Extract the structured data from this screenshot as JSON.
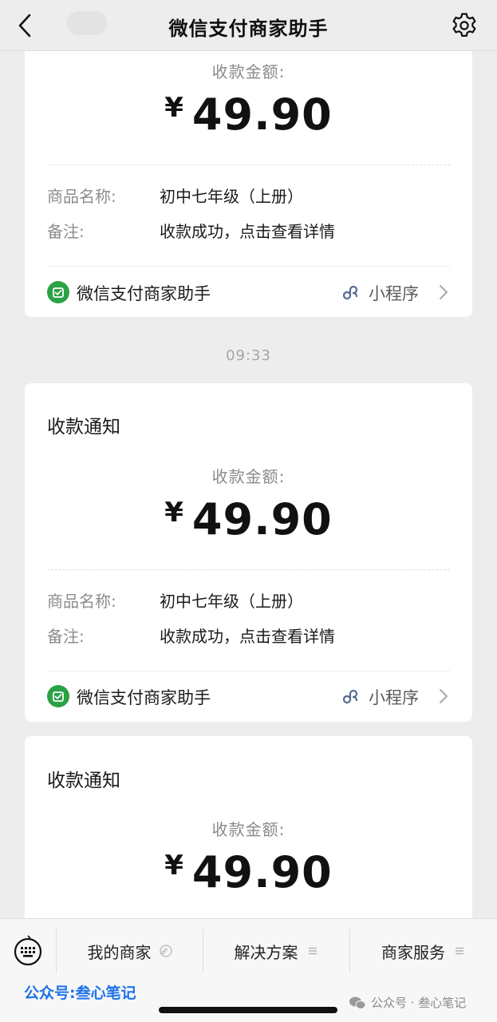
{
  "nav": {
    "title": "微信支付商家助手",
    "back_icon": "chevron-left-icon",
    "settings_icon": "gear-icon"
  },
  "cards": [
    {
      "title": "",
      "amount_label": "收款金额:",
      "currency": "¥",
      "amount": "49.90",
      "product_label": "商品名称:",
      "product_value": "初中七年级（上册）",
      "note_label": "备注:",
      "note_value": "收款成功，点击查看详情",
      "footer_name": "微信支付商家助手",
      "footer_link": "小程序"
    },
    {
      "title": "收款通知",
      "amount_label": "收款金额:",
      "currency": "¥",
      "amount": "49.90",
      "product_label": "商品名称:",
      "product_value": "初中七年级（上册）",
      "note_label": "备注:",
      "note_value": "收款成功，点击查看详情",
      "footer_name": "微信支付商家助手",
      "footer_link": "小程序"
    },
    {
      "title": "收款通知",
      "amount_label": "收款金额:",
      "currency": "¥",
      "amount": "49.90"
    }
  ],
  "timestamp": "09:33",
  "bottom_menu": {
    "items": [
      {
        "label": "我的商家",
        "icon": "mini-program-icon"
      },
      {
        "label": "解决方案",
        "icon": "menu-lines-icon"
      },
      {
        "label": "商家服务",
        "icon": "menu-lines-icon"
      }
    ],
    "keyboard_icon": "keyboard-icon"
  },
  "watermark": {
    "left_text": "公众号:叁心笔记",
    "right_text": "公众号 · 叁心笔记"
  },
  "colors": {
    "background": "#ededed",
    "card": "#ffffff",
    "wechat_green": "#2ba245",
    "link_blue": "#576b95",
    "watermark_blue": "#1e73e8"
  }
}
